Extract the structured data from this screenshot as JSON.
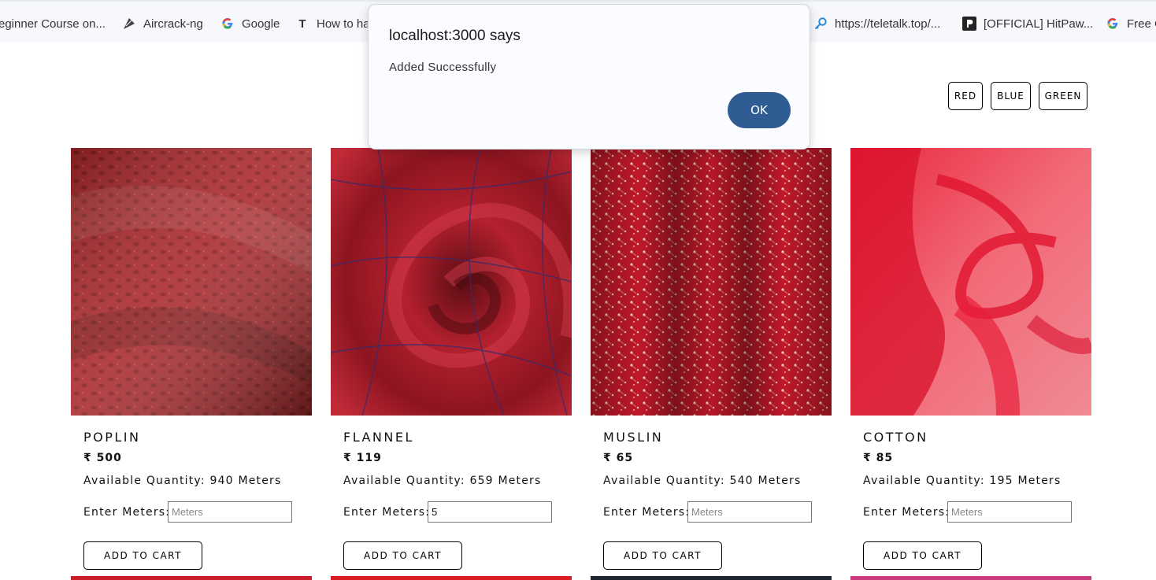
{
  "bookmarks": [
    {
      "label": "eginner Course on...",
      "icon": "bookmark-icon"
    },
    {
      "label": "Aircrack-ng",
      "icon": "aircrack-icon"
    },
    {
      "label": "Google",
      "icon": "google-icon"
    },
    {
      "label": "How to ha",
      "icon": "t-icon"
    },
    {
      "label": "https://teletalk.top/...",
      "icon": "key-icon"
    },
    {
      "label": "[OFFICIAL] HitPaw...",
      "icon": "hitpaw-icon"
    },
    {
      "label": "Free C",
      "icon": "google-icon"
    }
  ],
  "filters": [
    "RED",
    "BLUE",
    "GREEN"
  ],
  "products": [
    {
      "name": "POPLIN",
      "price": "₹ 500",
      "quantity": "Available Quantity: 940 Meters",
      "meters_label": "Enter Meters:",
      "meters_value": "",
      "meters_placeholder": "Meters",
      "cart_label": "ADD TO CART"
    },
    {
      "name": "FLANNEL",
      "price": "₹ 119",
      "quantity": "Available Quantity: 659 Meters",
      "meters_label": "Enter Meters:",
      "meters_value": "5",
      "meters_placeholder": "Meters",
      "cart_label": "ADD TO CART"
    },
    {
      "name": "MUSLIN",
      "price": "₹ 65",
      "quantity": "Available Quantity: 540 Meters",
      "meters_label": "Enter Meters:",
      "meters_value": "",
      "meters_placeholder": "Meters",
      "cart_label": "ADD TO CART"
    },
    {
      "name": "COTTON",
      "price": "₹ 85",
      "quantity": "Available Quantity: 195 Meters",
      "meters_label": "Enter Meters:",
      "meters_value": "",
      "meters_placeholder": "Meters",
      "cart_label": "ADD TO CART"
    }
  ],
  "dialog": {
    "title": "localhost:3000 says",
    "message": "Added Successfully",
    "ok_label": "OK"
  },
  "colors": {
    "ok_button": "#2f5d93",
    "fabric_red": "#b5202c"
  }
}
